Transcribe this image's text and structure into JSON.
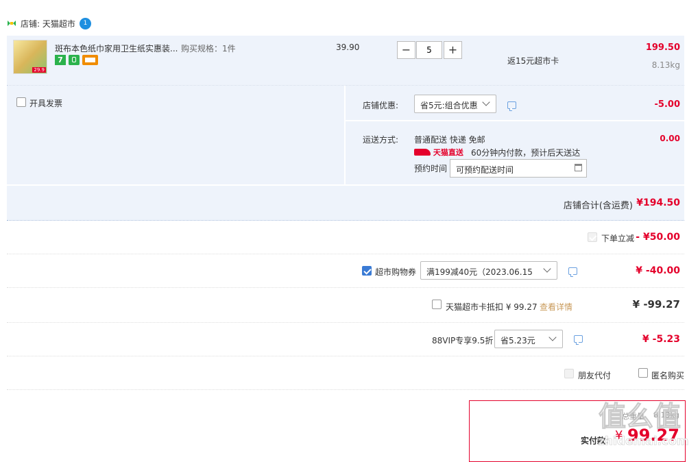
{
  "store": {
    "name": "店铺: 天猫超市",
    "badge": "1"
  },
  "product": {
    "title": "斑布本色纸巾家用卫生纸实惠装...",
    "spec": "购买规格：1件",
    "price": "39.90",
    "quantity": "5",
    "promo": "返15元超市卡",
    "subtotal": "199.50",
    "weight": "8.13kg",
    "thumb_tag": "29.9"
  },
  "invoice": {
    "label": "开具发票"
  },
  "store_discount": {
    "label": "店铺优惠:",
    "selected": "省5元:组合优惠",
    "amount": "-5.00"
  },
  "shipping": {
    "label": "运送方式:",
    "method": "普通配送 快递 免邮",
    "brand": "天猫直送",
    "note": "60分钟内付款，预计后天送达",
    "reserve_label": "预约时间",
    "reserve_placeholder": "可预约配送时间",
    "amount": "0.00"
  },
  "store_total": {
    "label": "店铺合计(含运费)",
    "amount": "¥194.50"
  },
  "instant_discount": {
    "label": "下单立减",
    "amount": "- ¥50.00"
  },
  "coupon": {
    "label": "超市购物券",
    "selected": "满199减40元（2023.06.15 ...",
    "amount": "¥ -40.00"
  },
  "card_deduct": {
    "label": "天猫超市卡抵扣 ¥ 99.27",
    "link": "查看详情",
    "amount": "¥ -99.27"
  },
  "vip": {
    "label": "88VIP专享9.5折",
    "selected": "省5.23元",
    "amount": "¥ -5.23"
  },
  "options": {
    "friend_pay": "朋友代付",
    "anonymous": "匿名购买"
  },
  "pay": {
    "weight_label": "总重量",
    "weight": "8.13kg",
    "label": "实付款:",
    "currency": "¥",
    "amount": "99.27"
  },
  "watermark": {
    "logo": "值么值",
    "site": "zhidemai.com"
  },
  "colors": {
    "accent_red": "#e4002b",
    "accent_blue": "#3a7bd5",
    "panel": "#eef3fb"
  }
}
